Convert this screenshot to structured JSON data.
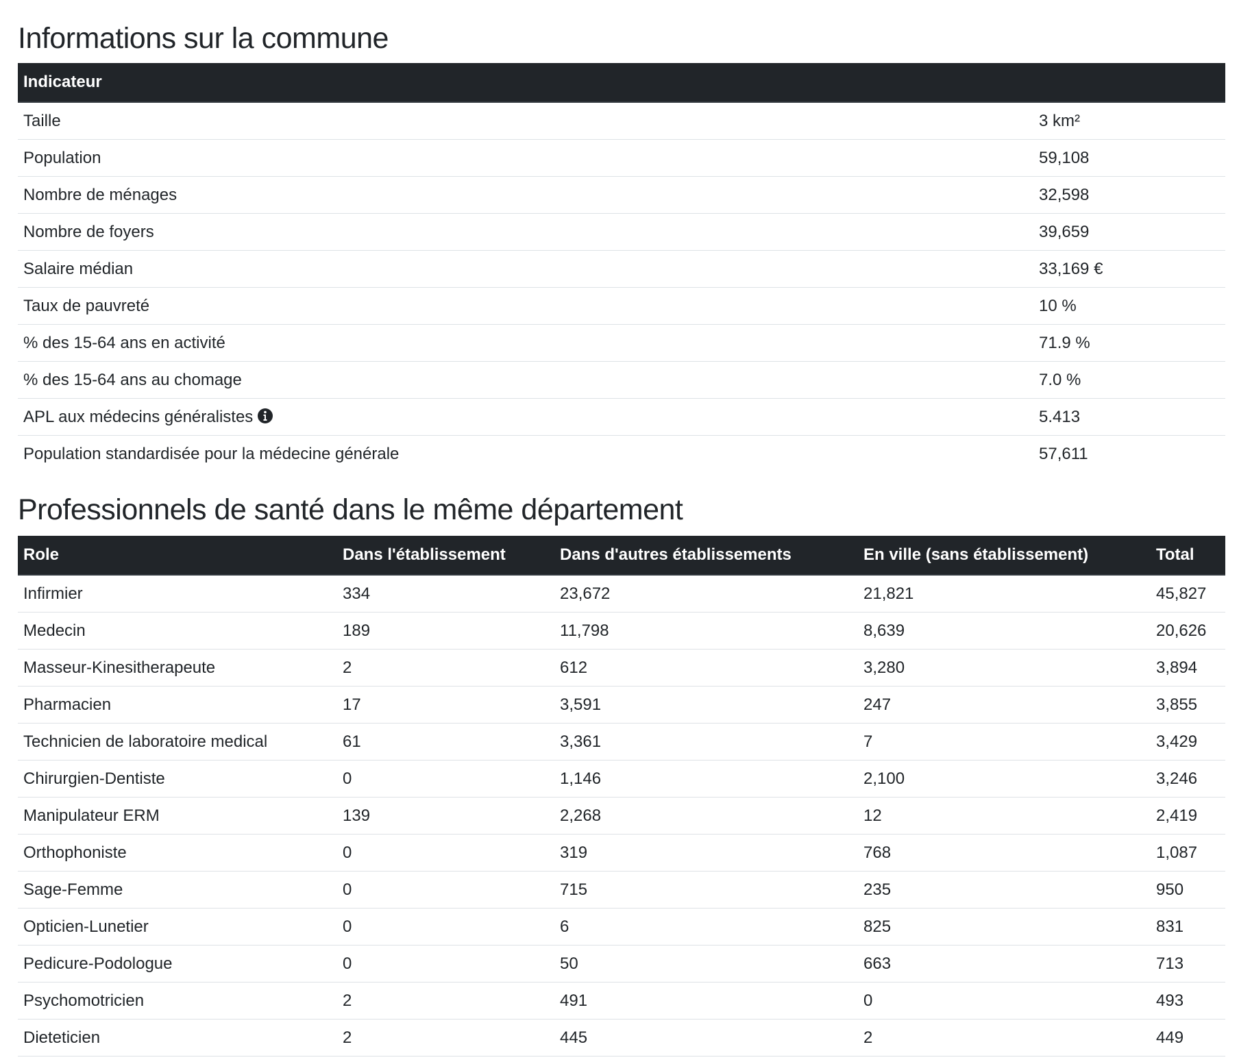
{
  "commune": {
    "title": "Informations sur la commune",
    "header": "Indicateur",
    "rows": [
      {
        "label": "Taille",
        "value": "3 km²"
      },
      {
        "label": "Population",
        "value": "59,108"
      },
      {
        "label": "Nombre de ménages",
        "value": "32,598"
      },
      {
        "label": "Nombre de foyers",
        "value": "39,659"
      },
      {
        "label": "Salaire médian",
        "value": "33,169 €"
      },
      {
        "label": "Taux de pauvreté",
        "value": "10 %"
      },
      {
        "label": "% des 15-64 ans en activité",
        "value": "71.9 %"
      },
      {
        "label": "% des 15-64 ans au chomage",
        "value": "7.0 %"
      },
      {
        "label": "APL aux médecins généralistes",
        "value": "5.413",
        "icon": "info-circle-icon"
      },
      {
        "label": "Population standardisée pour la médecine générale",
        "value": "57,611"
      }
    ]
  },
  "pros": {
    "title": "Professionnels de santé dans le même département",
    "headers": [
      "Role",
      "Dans l'établissement",
      "Dans d'autres établissements",
      "En ville (sans établissement)",
      "Total"
    ],
    "rows": [
      [
        "Infirmier",
        "334",
        "23,672",
        "21,821",
        "45,827"
      ],
      [
        "Medecin",
        "189",
        "11,798",
        "8,639",
        "20,626"
      ],
      [
        "Masseur-Kinesitherapeute",
        "2",
        "612",
        "3,280",
        "3,894"
      ],
      [
        "Pharmacien",
        "17",
        "3,591",
        "247",
        "3,855"
      ],
      [
        "Technicien de laboratoire medical",
        "61",
        "3,361",
        "7",
        "3,429"
      ],
      [
        "Chirurgien-Dentiste",
        "0",
        "1,146",
        "2,100",
        "3,246"
      ],
      [
        "Manipulateur ERM",
        "139",
        "2,268",
        "12",
        "2,419"
      ],
      [
        "Orthophoniste",
        "0",
        "319",
        "768",
        "1,087"
      ],
      [
        "Sage-Femme",
        "0",
        "715",
        "235",
        "950"
      ],
      [
        "Opticien-Lunetier",
        "0",
        "6",
        "825",
        "831"
      ],
      [
        "Pedicure-Podologue",
        "0",
        "50",
        "663",
        "713"
      ],
      [
        "Psychomotricien",
        "2",
        "491",
        "0",
        "493"
      ],
      [
        "Dieteticien",
        "2",
        "445",
        "2",
        "449"
      ]
    ]
  }
}
